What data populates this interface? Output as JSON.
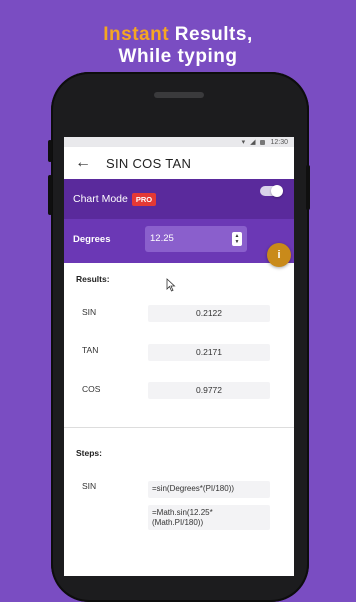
{
  "headline": {
    "line1_accent": "Instant",
    "line1_rest": " Results,",
    "line2": "While typing"
  },
  "statusbar": {
    "time": "12:30"
  },
  "appbar": {
    "back_icon": "arrow-left",
    "title": "SIN COS TAN"
  },
  "chart_mode": {
    "label": "Chart Mode",
    "badge": "PRO",
    "toggle_on": true
  },
  "degrees": {
    "label": "Degrees",
    "value": "12.25"
  },
  "info_button": {
    "icon": "info",
    "color": "#c98a1a"
  },
  "results": {
    "title": "Results:",
    "rows": [
      {
        "label": "SIN",
        "value": "0.2122"
      },
      {
        "label": "TAN",
        "value": "0.2171"
      },
      {
        "label": "COS",
        "value": "0.9772"
      }
    ]
  },
  "steps": {
    "title": "Steps:",
    "label": "SIN",
    "formula_1": "=sin(Degrees*(PI/180))",
    "formula_2_line1": "=Math.sin(12.25*",
    "formula_2_line2": "(Math.PI/180))"
  },
  "colors": {
    "background": "#7a4dc2",
    "accent": "#f5a623",
    "toolbar": "#5a2a9c",
    "pro_badge": "#e53935"
  }
}
